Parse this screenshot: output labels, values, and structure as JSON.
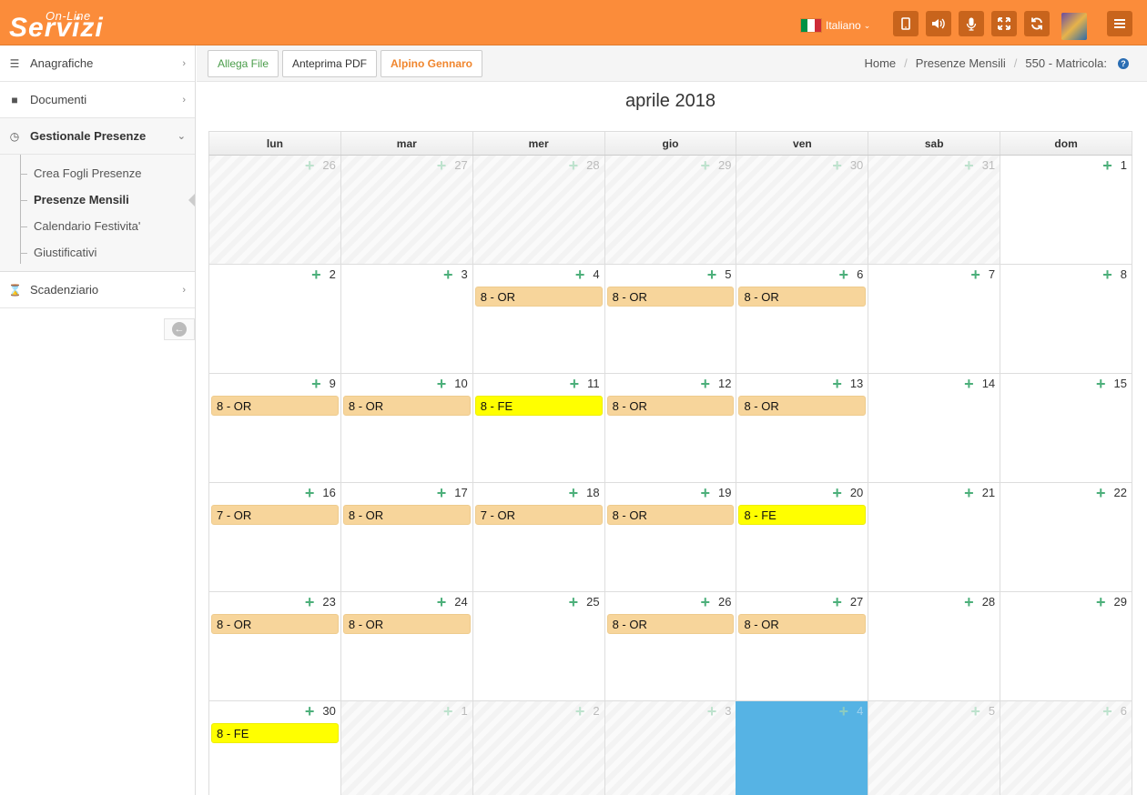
{
  "app": {
    "logo_small": "On-Line",
    "logo_big": "Servizi",
    "language": "Italiano"
  },
  "colors": {
    "topbar": "#fb8c3a",
    "event_or": "#f7d59b",
    "event_fe": "#ffff00",
    "today": "#56b3e4",
    "add_icon": "#4caf7a"
  },
  "topbar_buttons": [
    "tablet-icon",
    "volume-icon",
    "microphone-icon",
    "fullscreen-icon",
    "refresh-icon"
  ],
  "sidebar": {
    "items": [
      {
        "label": "Anagrafiche",
        "icon": "database-icon"
      },
      {
        "label": "Documenti",
        "icon": "folder-icon"
      },
      {
        "label": "Gestionale Presenze",
        "icon": "clock-icon"
      },
      {
        "label": "Scadenziario",
        "icon": "hourglass-icon"
      }
    ],
    "subitems": [
      "Crea Fogli Presenze",
      "Presenze Mensili",
      "Calendario Festivita'",
      "Giustificativi"
    ]
  },
  "actions": {
    "attach": "Allega File",
    "pdf": "Anteprima PDF",
    "employee": "Alpino Gennaro"
  },
  "breadcrumb": [
    "Home",
    "Presenze Mensili",
    "550 - Matricola:"
  ],
  "calendar": {
    "title": "aprile 2018",
    "weekdays": [
      "lun",
      "mar",
      "mer",
      "gio",
      "ven",
      "sab",
      "dom"
    ],
    "weeks": [
      [
        {
          "day": "26",
          "other": true
        },
        {
          "day": "27",
          "other": true
        },
        {
          "day": "28",
          "other": true
        },
        {
          "day": "29",
          "other": true
        },
        {
          "day": "30",
          "other": true
        },
        {
          "day": "31",
          "other": true
        },
        {
          "day": "1"
        }
      ],
      [
        {
          "day": "2"
        },
        {
          "day": "3"
        },
        {
          "day": "4",
          "event": "8 - OR",
          "type": "or"
        },
        {
          "day": "5",
          "event": "8 - OR",
          "type": "or"
        },
        {
          "day": "6",
          "event": "8 - OR",
          "type": "or"
        },
        {
          "day": "7"
        },
        {
          "day": "8"
        }
      ],
      [
        {
          "day": "9",
          "event": "8 - OR",
          "type": "or"
        },
        {
          "day": "10",
          "event": "8 - OR",
          "type": "or"
        },
        {
          "day": "11",
          "event": "8 - FE",
          "type": "fe"
        },
        {
          "day": "12",
          "event": "8 - OR",
          "type": "or"
        },
        {
          "day": "13",
          "event": "8 - OR",
          "type": "or"
        },
        {
          "day": "14"
        },
        {
          "day": "15"
        }
      ],
      [
        {
          "day": "16",
          "event": "7 - OR",
          "type": "or"
        },
        {
          "day": "17",
          "event": "8 - OR",
          "type": "or"
        },
        {
          "day": "18",
          "event": "7 - OR",
          "type": "or"
        },
        {
          "day": "19",
          "event": "8 - OR",
          "type": "or"
        },
        {
          "day": "20",
          "event": "8 - FE",
          "type": "fe"
        },
        {
          "day": "21"
        },
        {
          "day": "22"
        }
      ],
      [
        {
          "day": "23",
          "event": "8 - OR",
          "type": "or"
        },
        {
          "day": "24",
          "event": "8 - OR",
          "type": "or"
        },
        {
          "day": "25"
        },
        {
          "day": "26",
          "event": "8 - OR",
          "type": "or"
        },
        {
          "day": "27",
          "event": "8 - OR",
          "type": "or"
        },
        {
          "day": "28"
        },
        {
          "day": "29"
        }
      ],
      [
        {
          "day": "30",
          "event": "8 - FE",
          "type": "fe"
        },
        {
          "day": "1",
          "other": true
        },
        {
          "day": "2",
          "other": true
        },
        {
          "day": "3",
          "other": true
        },
        {
          "day": "4",
          "other": true,
          "today": true
        },
        {
          "day": "5",
          "other": true
        },
        {
          "day": "6",
          "other": true
        }
      ]
    ]
  }
}
